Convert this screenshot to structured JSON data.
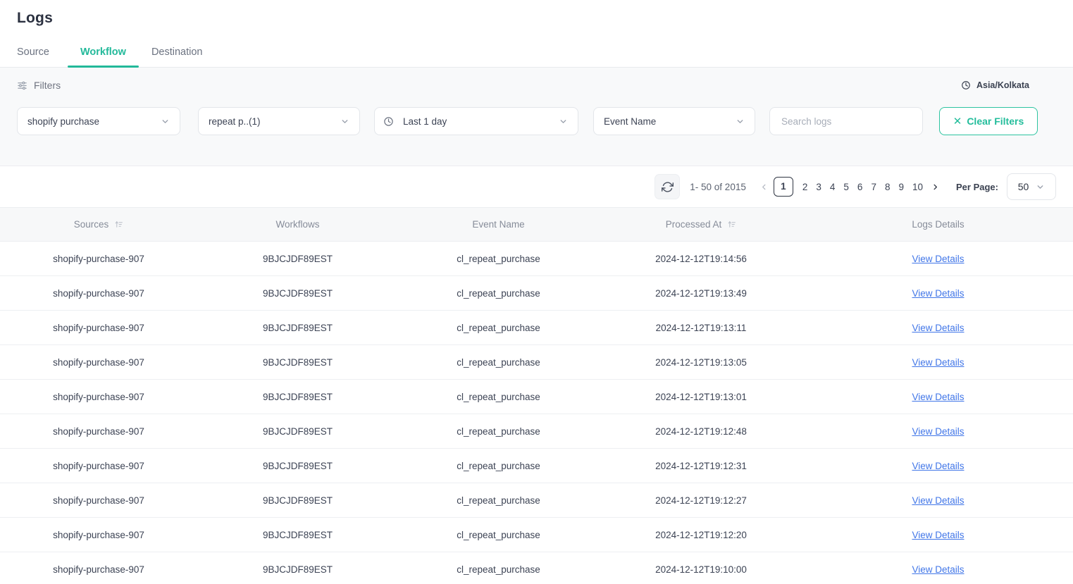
{
  "header": {
    "title": "Logs"
  },
  "tabs": [
    {
      "label": "Source",
      "active": false
    },
    {
      "label": "Workflow",
      "active": true
    },
    {
      "label": "Destination",
      "active": false
    }
  ],
  "filters": {
    "label": "Filters",
    "filter_icon": "sliders-icon",
    "timezone": {
      "icon": "clock-icon",
      "label": "Asia/Kolkata"
    },
    "source": {
      "value": "shopify purchase",
      "icon": "chevron-down-icon"
    },
    "workflow": {
      "value": "repeat p..(1)",
      "icon": "chevron-down-icon"
    },
    "time_range": {
      "value": "Last 1 day",
      "icon": "clock-icon",
      "chevron": "chevron-down-icon"
    },
    "event_name": {
      "value": "Event Name",
      "icon": "chevron-down-icon"
    },
    "search": {
      "value": "",
      "placeholder": "Search logs"
    },
    "clear": {
      "label": "Clear Filters",
      "icon": "close-x-icon"
    }
  },
  "pagination": {
    "refresh_icon": "refresh-icon",
    "range_text": "1- 50 of 2015",
    "prev_icon": "chevron-left-icon",
    "next_icon": "chevron-right-icon",
    "pages": [
      "1",
      "2",
      "3",
      "4",
      "5",
      "6",
      "7",
      "8",
      "9",
      "10"
    ],
    "current_page": "1",
    "per_page_label": "Per Page:",
    "per_page_value": "50",
    "per_page_icon": "chevron-down-icon"
  },
  "table": {
    "columns": [
      {
        "label": "Sources",
        "sortable": true,
        "sort_icon": "sort-icon"
      },
      {
        "label": "Workflows",
        "sortable": false
      },
      {
        "label": "Event Name",
        "sortable": false
      },
      {
        "label": "Processed At",
        "sortable": true,
        "sort_icon": "sort-icon"
      },
      {
        "label": "Logs Details",
        "sortable": false
      }
    ],
    "details_link_label": "View Details",
    "rows": [
      {
        "source": "shopify-purchase-907",
        "workflow": "9BJCJDF89EST",
        "event": "cl_repeat_purchase",
        "processed_at": "2024-12-12T19:14:56"
      },
      {
        "source": "shopify-purchase-907",
        "workflow": "9BJCJDF89EST",
        "event": "cl_repeat_purchase",
        "processed_at": "2024-12-12T19:13:49"
      },
      {
        "source": "shopify-purchase-907",
        "workflow": "9BJCJDF89EST",
        "event": "cl_repeat_purchase",
        "processed_at": "2024-12-12T19:13:11"
      },
      {
        "source": "shopify-purchase-907",
        "workflow": "9BJCJDF89EST",
        "event": "cl_repeat_purchase",
        "processed_at": "2024-12-12T19:13:05"
      },
      {
        "source": "shopify-purchase-907",
        "workflow": "9BJCJDF89EST",
        "event": "cl_repeat_purchase",
        "processed_at": "2024-12-12T19:13:01"
      },
      {
        "source": "shopify-purchase-907",
        "workflow": "9BJCJDF89EST",
        "event": "cl_repeat_purchase",
        "processed_at": "2024-12-12T19:12:48"
      },
      {
        "source": "shopify-purchase-907",
        "workflow": "9BJCJDF89EST",
        "event": "cl_repeat_purchase",
        "processed_at": "2024-12-12T19:12:31"
      },
      {
        "source": "shopify-purchase-907",
        "workflow": "9BJCJDF89EST",
        "event": "cl_repeat_purchase",
        "processed_at": "2024-12-12T19:12:27"
      },
      {
        "source": "shopify-purchase-907",
        "workflow": "9BJCJDF89EST",
        "event": "cl_repeat_purchase",
        "processed_at": "2024-12-12T19:12:20"
      },
      {
        "source": "shopify-purchase-907",
        "workflow": "9BJCJDF89EST",
        "event": "cl_repeat_purchase",
        "processed_at": "2024-12-12T19:10:00"
      }
    ]
  },
  "colors": {
    "accent_green": "#22b99a",
    "link_blue": "#4176e8",
    "panel_bg": "#f8f9fa",
    "text_dark": "#3c4354"
  }
}
